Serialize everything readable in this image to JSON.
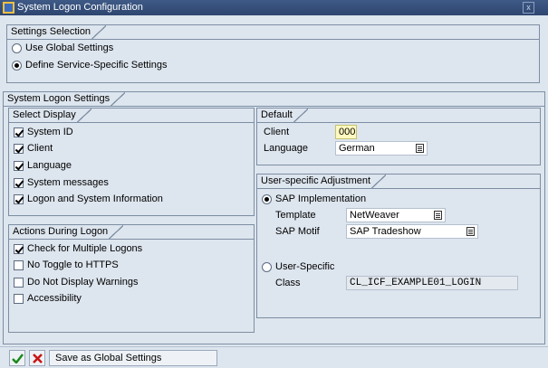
{
  "window": {
    "title": "System Logon Configuration",
    "close_icon": "close-icon"
  },
  "settings_selection": {
    "title": "Settings Selection",
    "options": [
      {
        "label": "Use Global Settings",
        "selected": false
      },
      {
        "label": "Define Service-Specific Settings",
        "selected": true
      }
    ]
  },
  "system_logon_settings": {
    "title": "System Logon Settings"
  },
  "select_display": {
    "title": "Select Display",
    "items": [
      {
        "label": "System ID",
        "checked": true
      },
      {
        "label": "Client",
        "checked": true
      },
      {
        "label": "Language",
        "checked": true
      },
      {
        "label": "System messages",
        "checked": true
      },
      {
        "label": "Logon and System Information",
        "checked": true
      }
    ]
  },
  "actions_during_logon": {
    "title": "Actions During Logon",
    "items": [
      {
        "label": "Check for Multiple Logons",
        "checked": true
      },
      {
        "label": "No Toggle to HTTPS",
        "checked": false
      },
      {
        "label": "Do Not Display Warnings",
        "checked": false
      },
      {
        "label": "Accessibility",
        "checked": false
      }
    ]
  },
  "default": {
    "title": "Default",
    "client_label": "Client",
    "client_value": "000",
    "language_label": "Language",
    "language_value": "German"
  },
  "user_specific": {
    "title": "User-specific Adjustment",
    "sap_impl_label": "SAP Implementation",
    "sap_impl_selected": true,
    "template_label": "Template",
    "template_value": "NetWeaver",
    "motif_label": "SAP Motif",
    "motif_value": "SAP Tradeshow",
    "user_specific_label": "User-Specific",
    "user_specific_selected": false,
    "class_label": "Class",
    "class_value": "CL_ICF_EXAMPLE01_LOGIN"
  },
  "footer": {
    "save_global_label": "Save as Global Settings",
    "confirm_icon": "checkmark-icon",
    "cancel_icon": "cancel-icon"
  }
}
